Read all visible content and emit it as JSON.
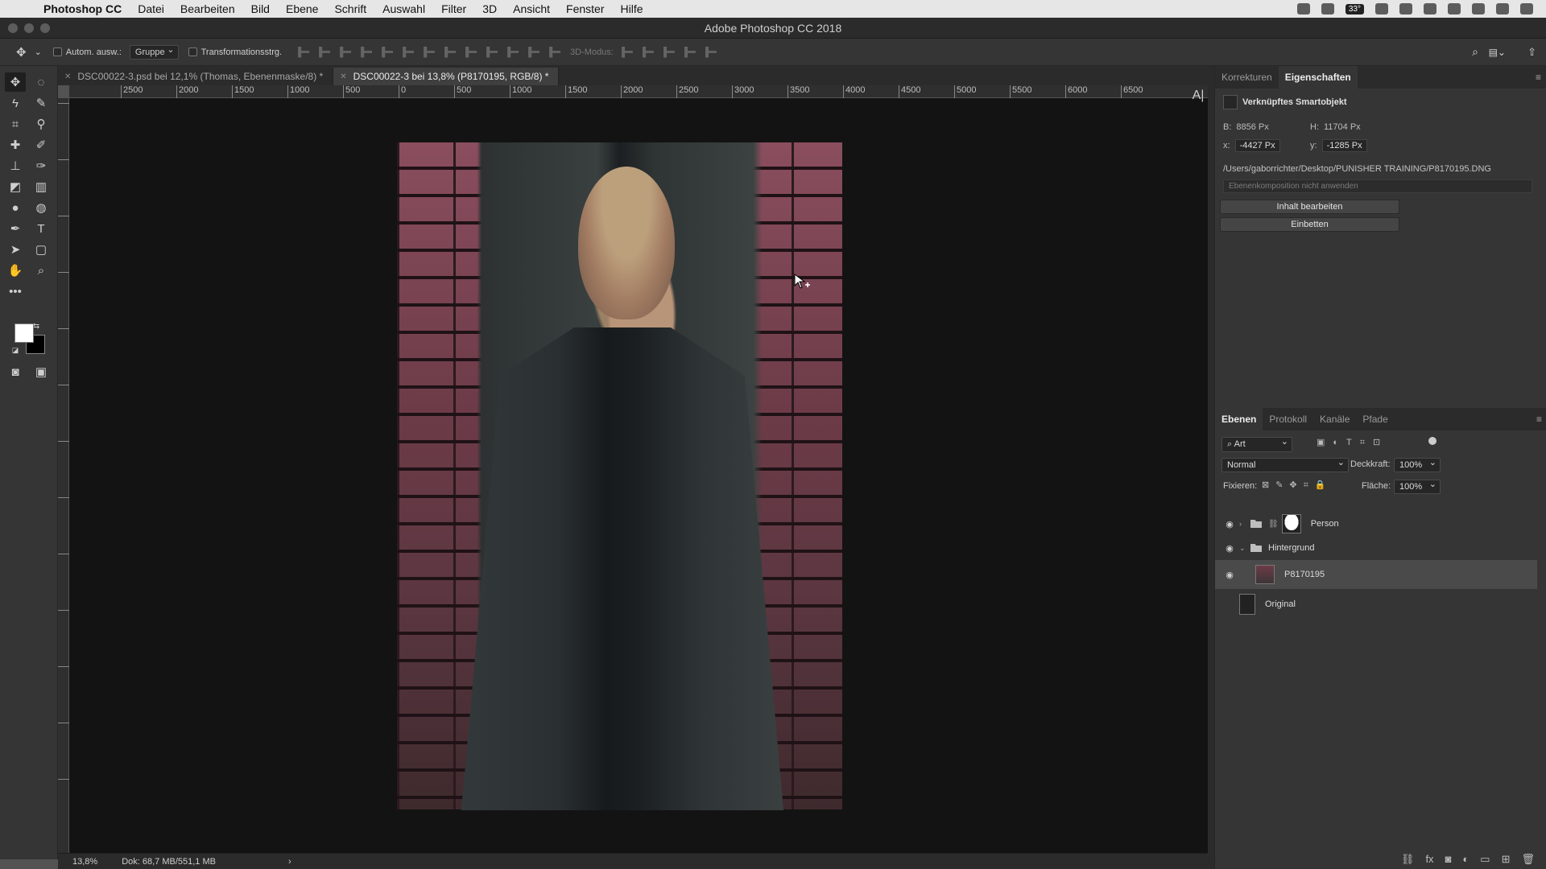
{
  "menubar": {
    "app": "Photoshop CC",
    "items": [
      "Datei",
      "Bearbeiten",
      "Bild",
      "Ebene",
      "Schrift",
      "Auswahl",
      "Filter",
      "3D",
      "Ansicht",
      "Fenster",
      "Hilfe"
    ],
    "temp": "33°"
  },
  "window": {
    "title": "Adobe Photoshop CC 2018"
  },
  "options": {
    "auto_select": "Autom. ausw.:",
    "group": "Gruppe",
    "transform": "Transformationsstrg.",
    "mode3d": "3D-Modus:"
  },
  "tabs": [
    {
      "label": "DSC00022-3.psd bei 12,1% (Thomas, Ebenenmaske/8) *"
    },
    {
      "label": "DSC00022-3 bei 13,8% (P8170195, RGB/8) *"
    }
  ],
  "ruler": {
    "top": [
      "2500",
      "2000",
      "1500",
      "1000",
      "500",
      "0",
      "500",
      "1000",
      "1500",
      "2000",
      "2500",
      "3000",
      "3500",
      "4000",
      "4500",
      "5000",
      "5500",
      "6000",
      "6500"
    ]
  },
  "status": {
    "zoom": "13,8%",
    "doc": "Dok: 68,7 MB/551,1 MB",
    "arrow": "›"
  },
  "properties": {
    "tabs": [
      "Korrekturen",
      "Eigenschaften"
    ],
    "type": "Verknüpftes Smartobjekt",
    "w_label": "B:",
    "w_value": "8856 Px",
    "h_label": "H:",
    "h_value": "11704 Px",
    "x_label": "x:",
    "x_value": "-4427 Px",
    "y_label": "y:",
    "y_value": "-1285 Px",
    "path": "/Users/gaborrichter/Desktop/PUNISHER TRAINING/P8170195.DNG",
    "comp": "Ebenenkomposition nicht anwenden",
    "edit_btn": "Inhalt bearbeiten",
    "embed_btn": "Einbetten"
  },
  "layers_panel": {
    "tabs": [
      "Ebenen",
      "Protokoll",
      "Kanäle",
      "Pfade"
    ],
    "filter": "Art",
    "blend": "Normal",
    "opacity_label": "Deckkraft:",
    "opacity": "100%",
    "lock_label": "Fixieren:",
    "fill_label": "Fläche:",
    "fill": "100%",
    "layers": [
      {
        "name": "Person"
      },
      {
        "name": "Hintergrund"
      },
      {
        "name": "P8170195"
      },
      {
        "name": "Original"
      }
    ]
  }
}
